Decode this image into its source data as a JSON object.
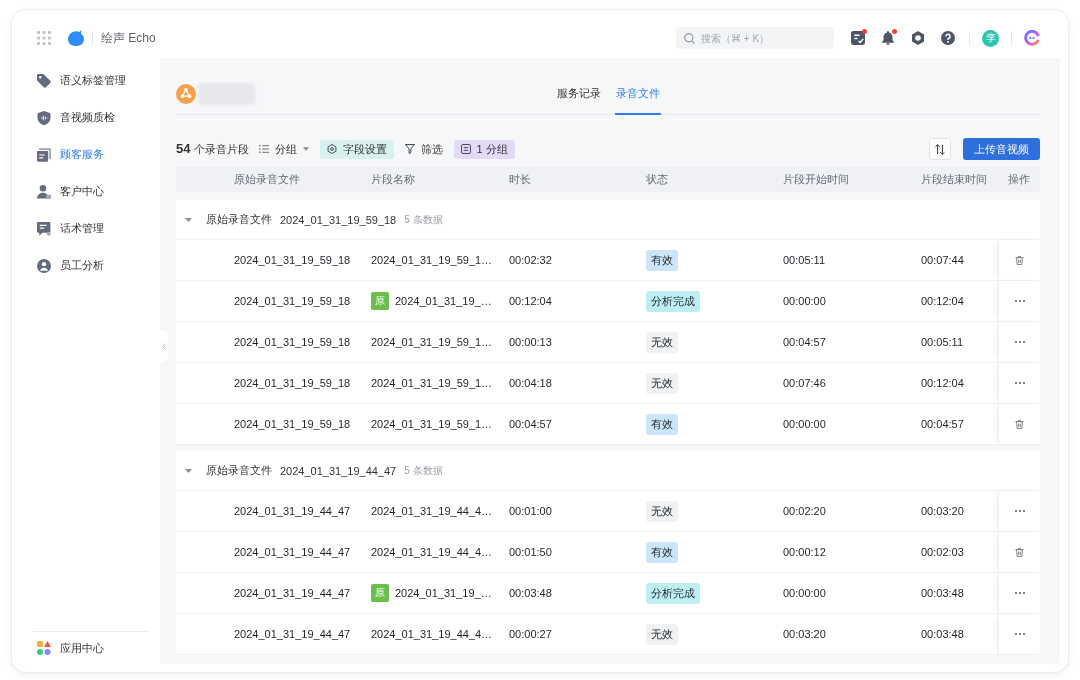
{
  "app": {
    "title": "绘声 Echo"
  },
  "search": {
    "placeholder": "搜索（⌘ + K）"
  },
  "header_icons": [
    {
      "badge": true
    },
    {
      "badge": true
    },
    {
      "badge": false
    },
    {
      "badge": false
    }
  ],
  "user": {
    "initial": "李"
  },
  "sidebar": {
    "items": [
      {
        "label": "语义标签管理",
        "selected": false
      },
      {
        "label": "音视频质检",
        "selected": false
      },
      {
        "label": "顾客服务",
        "selected": true
      },
      {
        "label": "客户中心",
        "selected": false
      },
      {
        "label": "话术管理",
        "selected": false
      },
      {
        "label": "员工分析",
        "selected": false
      }
    ],
    "footer": {
      "label": "应用中心"
    }
  },
  "tabs": [
    {
      "label": "服务记录",
      "selected": false
    },
    {
      "label": "录音文件",
      "selected": true
    }
  ],
  "toolbar": {
    "count": "**54** 个录音片段",
    "group_by": "分组",
    "field_settings": "字段设置",
    "filter": "筛选",
    "groups": "1 分组",
    "upload": "上传音视频"
  },
  "table": {
    "columns": [
      "原始录音文件",
      "片段名称",
      "时长",
      "状态",
      "片段开始时间",
      "片段结束时间",
      "操作"
    ],
    "groups": [
      {
        "label": "原始录音文件",
        "file": "2024_01_31_19_59_18",
        "count": "5 条数据",
        "expanded": true,
        "rows": [
          {
            "source": "2024_01_31_19_59_18",
            "name": "2024_01_31_19_59_1…",
            "duration": "00:02:32",
            "status": {
              "label": "有效",
              "color": "#cde5fa"
            },
            "start": "00:05:11",
            "end": "00:07:44",
            "action": {
              "kind": "delete"
            }
          },
          {
            "source": "2024_01_31_19_59_18",
            "tag": "原",
            "name": "2024_01_31_19_…",
            "duration": "00:12:04",
            "status": {
              "label": "分析完成",
              "color": "#bdeef1"
            },
            "start": "00:00:00",
            "end": "00:12:04",
            "action": {
              "kind": "more"
            }
          },
          {
            "source": "2024_01_31_19_59_18",
            "name": "2024_01_31_19_59_1…",
            "duration": "00:00:13",
            "status": {
              "label": "无效",
              "color": "#eff1f3"
            },
            "start": "00:04:57",
            "end": "00:05:11",
            "action": {
              "kind": "more"
            }
          },
          {
            "source": "2024_01_31_19_59_18",
            "name": "2024_01_31_19_59_1…",
            "duration": "00:04:18",
            "status": {
              "label": "无效",
              "color": "#eff1f3"
            },
            "start": "00:07:46",
            "end": "00:12:04",
            "action": {
              "kind": "more"
            }
          },
          {
            "source": "2024_01_31_19_59_18",
            "name": "2024_01_31_19_59_1…",
            "duration": "00:04:57",
            "status": {
              "label": "有效",
              "color": "#cde5fa"
            },
            "start": "00:00:00",
            "end": "00:04:57",
            "action": {
              "kind": "delete"
            }
          }
        ]
      },
      {
        "label": "原始录音文件",
        "file": "2024_01_31_19_44_47",
        "count": "5 条数据",
        "expanded": true,
        "rows": [
          {
            "source": "2024_01_31_19_44_47",
            "name": "2024_01_31_19_44_4…",
            "duration": "00:01:00",
            "status": {
              "label": "无效",
              "color": "#eff1f3"
            },
            "start": "00:02:20",
            "end": "00:03:20",
            "action": {
              "kind": "more"
            }
          },
          {
            "source": "2024_01_31_19_44_47",
            "name": "2024_01_31_19_44_4…",
            "duration": "00:01:50",
            "status": {
              "label": "有效",
              "color": "#cde5fa"
            },
            "start": "00:00:12",
            "end": "00:02:03",
            "action": {
              "kind": "delete"
            }
          },
          {
            "source": "2024_01_31_19_44_47",
            "tag": "原",
            "name": "2024_01_31_19_…",
            "duration": "00:03:48",
            "status": {
              "label": "分析完成",
              "color": "#bdeef1"
            },
            "start": "00:00:00",
            "end": "00:03:48",
            "action": {
              "kind": "more"
            }
          },
          {
            "source": "2024_01_31_19_44_47",
            "name": "2024_01_31_19_44_4…",
            "duration": "00:00:27",
            "status": {
              "label": "无效",
              "color": "#eff1f3"
            },
            "start": "00:03:20",
            "end": "00:03:48",
            "action": {
              "kind": "more"
            }
          }
        ]
      }
    ]
  }
}
